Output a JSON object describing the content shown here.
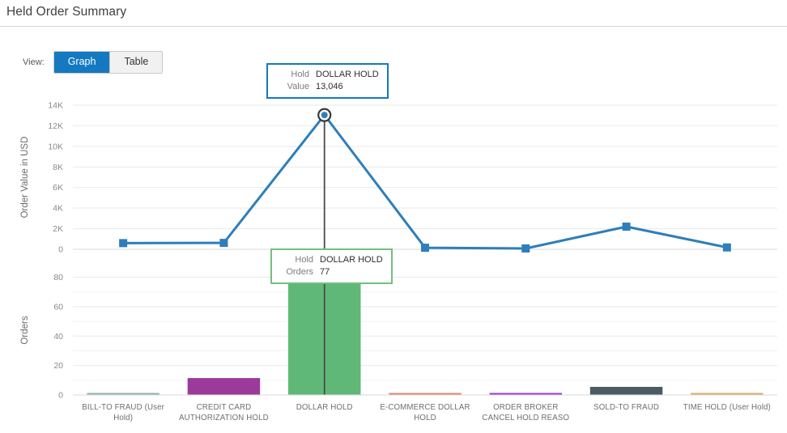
{
  "header": {
    "title": "Held Order Summary"
  },
  "toolbar": {
    "view_label": "View:",
    "graph_label": "Graph",
    "table_label": "Table",
    "active_view": "Graph"
  },
  "tooltips": [
    {
      "id": "value-tooltip",
      "accent": "#1479c0",
      "rows": [
        {
          "key": "Hold",
          "value": "DOLLAR HOLD"
        },
        {
          "key": "Value",
          "value": "13,046"
        }
      ]
    },
    {
      "id": "orders-tooltip",
      "accent": "#74bf7f",
      "rows": [
        {
          "key": "Hold",
          "value": "DOLLAR HOLD"
        },
        {
          "key": "Orders",
          "value": "77"
        }
      ]
    }
  ],
  "chart_data": [
    {
      "type": "line",
      "title": "",
      "ylabel": "Order Value in USD",
      "xlabel": "",
      "ylim": [
        0,
        14000
      ],
      "yticks": [
        0,
        2000,
        4000,
        6000,
        8000,
        10000,
        12000,
        14000
      ],
      "ytick_labels": [
        "0",
        "2K",
        "4K",
        "6K",
        "8K",
        "10K",
        "12K",
        "14K"
      ],
      "grid": true,
      "legend": "none",
      "series_color": "#2e7ebb",
      "categories": [
        "BILL-TO FRAUD (User Hold)",
        "CREDIT CARD AUTHORIZATION HOLD",
        "DOLLAR HOLD",
        "E-COMMERCE DOLLAR HOLD",
        "ORDER BROKER CANCEL HOLD REASO",
        "SOLD-TO FRAUD",
        "TIME HOLD (User Hold)"
      ],
      "values": [
        600,
        620,
        13046,
        150,
        80,
        2200,
        180
      ],
      "highlighted_index": 2,
      "highlighted_value": 13046
    },
    {
      "type": "bar",
      "title": "",
      "ylabel": "Orders",
      "xlabel": "",
      "ylim": [
        0,
        88
      ],
      "yticks": [
        0,
        20,
        40,
        60,
        80
      ],
      "ytick_labels": [
        "0",
        "20",
        "40",
        "60",
        "80"
      ],
      "minor_yticks": [
        10,
        30,
        50,
        70
      ],
      "grid": true,
      "legend": "none",
      "categories": [
        "BILL-TO FRAUD (User Hold)",
        "CREDIT CARD AUTHORIZATION HOLD",
        "DOLLAR HOLD",
        "E-COMMERCE DOLLAR HOLD",
        "ORDER BROKER CANCEL HOLD REASO",
        "SOLD-TO FRAUD",
        "TIME HOLD (User Hold)"
      ],
      "values": [
        1,
        11.5,
        77,
        0.7,
        1,
        5.5,
        0.8
      ],
      "colors": [
        "#8fb3b3",
        "#9c3a9c",
        "#5fb878",
        "#e08a7a",
        "#9b3ce8",
        "#4b5b63",
        "#dfae6a"
      ],
      "highlighted_index": 2,
      "highlighted_value": 77
    }
  ],
  "category_labels": [
    [
      "BILL-TO FRAUD (User",
      "Hold)"
    ],
    [
      "CREDIT CARD",
      "AUTHORIZATION HOLD"
    ],
    [
      "DOLLAR HOLD",
      ""
    ],
    [
      "E-COMMERCE DOLLAR",
      "HOLD"
    ],
    [
      "ORDER BROKER",
      "CANCEL HOLD REASO"
    ],
    [
      "SOLD-TO FRAUD",
      ""
    ],
    [
      "TIME HOLD (User Hold)",
      ""
    ]
  ]
}
